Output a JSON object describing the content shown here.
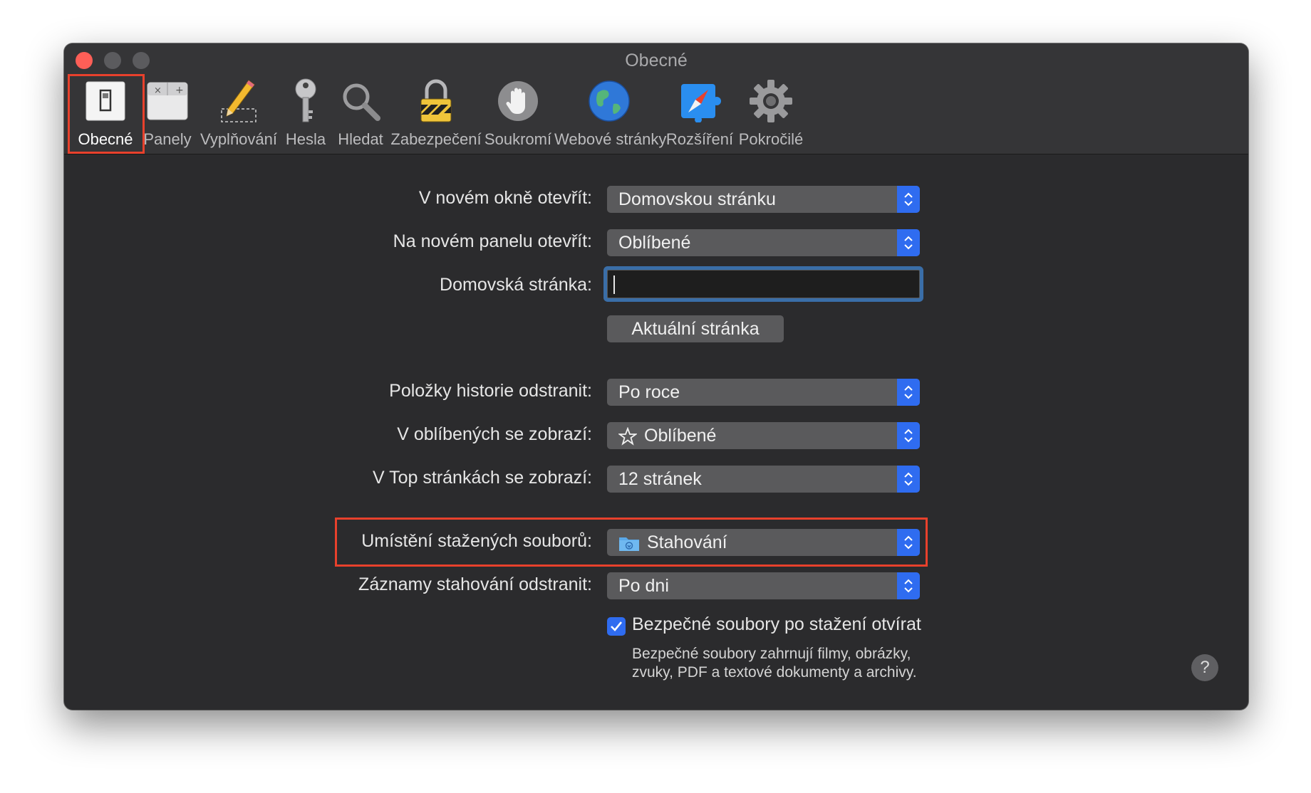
{
  "window": {
    "title": "Obecné"
  },
  "toolbar": {
    "items": [
      {
        "label": "Obecné",
        "icon": "switch-icon"
      },
      {
        "label": "Panely",
        "icon": "tabs-icon"
      },
      {
        "label": "Vyplňování",
        "icon": "pencil-icon"
      },
      {
        "label": "Hesla",
        "icon": "key-icon"
      },
      {
        "label": "Hledat",
        "icon": "magnifier-icon"
      },
      {
        "label": "Zabezpečení",
        "icon": "padlock-icon"
      },
      {
        "label": "Soukromí",
        "icon": "hand-icon"
      },
      {
        "label": "Webové stránky",
        "icon": "globe-icon"
      },
      {
        "label": "Rozšíření",
        "icon": "puzzle-compass-icon"
      },
      {
        "label": "Pokročilé",
        "icon": "gear-icon"
      }
    ],
    "selected": "Obecné"
  },
  "form": {
    "new_window_label": "V novém okně otevřít:",
    "new_window_value": "Domovskou stránku",
    "new_tab_label": "Na novém panelu otevřít:",
    "new_tab_value": "Oblíbené",
    "homepage_label": "Domovská stránka:",
    "homepage_value": "",
    "current_page_button": "Aktuální stránka",
    "history_label": "Položky historie odstranit:",
    "history_value": "Po roce",
    "favorites_label": "V oblíbených se zobrazí:",
    "favorites_value": "Oblíbené",
    "topsites_label": "V Top stránkách se zobrazí:",
    "topsites_value": "12 stránek",
    "download_location_label": "Umístění stažených souborů:",
    "download_location_value": "Stahování",
    "download_remove_label": "Záznamy stahování odstranit:",
    "download_remove_value": "Po dni",
    "open_safe_label": "Bezpečné soubory po stažení otvírat",
    "open_safe_checked": true,
    "open_safe_note_line1": "Bezpečné soubory zahrnují filmy, obrázky,",
    "open_safe_note_line2": "zvuky, PDF a textové dokumenty a archivy."
  },
  "help": {
    "symbol": "?"
  },
  "colors": {
    "accent": "#2f6cf0",
    "highlight": "#e8412c",
    "window_bg": "#2b2b2d"
  }
}
